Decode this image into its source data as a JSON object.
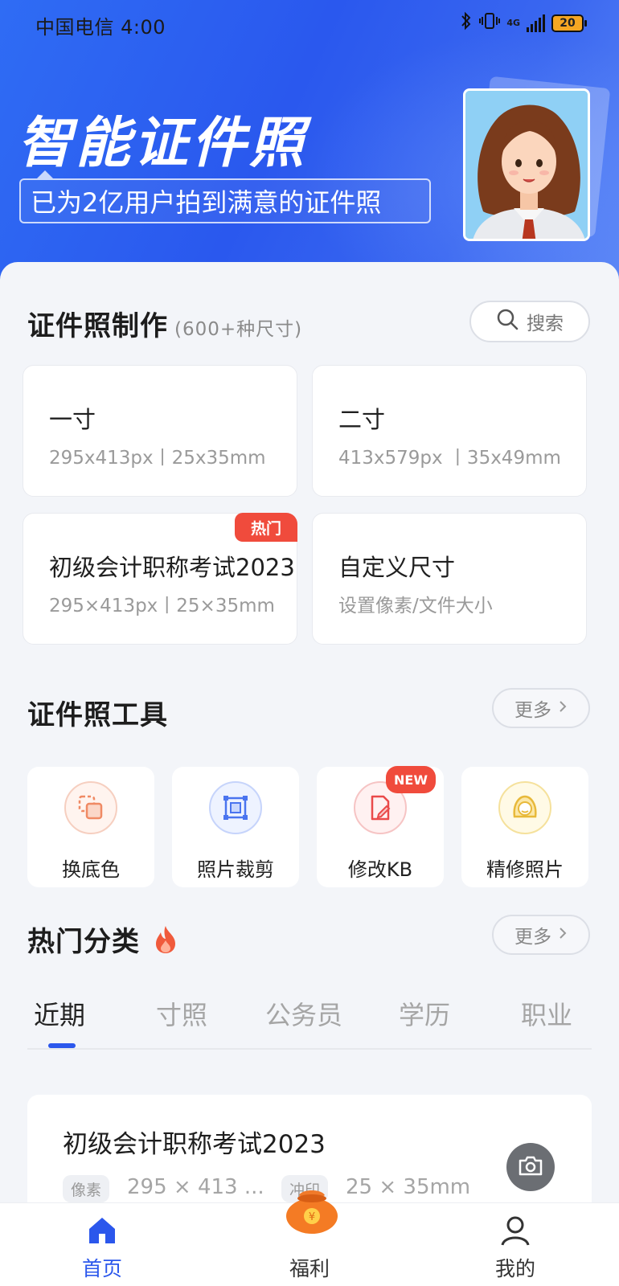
{
  "status_bar": {
    "carrier_time": "中国电信 4:00",
    "network": "4G",
    "battery": "20"
  },
  "hero": {
    "title": "智能证件照",
    "subtitle": "已为2亿用户拍到满意的证件照"
  },
  "make_section": {
    "title": "证件照制作",
    "note": "(600+种尺寸)",
    "search_label": "搜索",
    "cards": [
      {
        "title": "一寸",
        "sub": "295x413px丨25x35mm"
      },
      {
        "title": "二寸",
        "sub": "413x579px 丨35x49mm"
      },
      {
        "title": "初级会计职称考试2023",
        "sub": "295×413px丨25×35mm",
        "tag": "热门"
      },
      {
        "title": "自定义尺寸",
        "sub": "设置像素/文件大小"
      }
    ]
  },
  "tools_section": {
    "title": "证件照工具",
    "more_label": "更多",
    "tools": [
      {
        "label": "换底色",
        "icon": "swap-background-icon"
      },
      {
        "label": "照片裁剪",
        "icon": "crop-icon"
      },
      {
        "label": "修改KB",
        "icon": "edit-file-icon",
        "tag": "NEW"
      },
      {
        "label": "精修照片",
        "icon": "face-retouch-icon"
      }
    ]
  },
  "hot_section": {
    "title": "热门分类",
    "more_label": "更多",
    "tabs": [
      "近期",
      "寸照",
      "公务员",
      "学历",
      "职业"
    ],
    "active_tab": "近期",
    "item": {
      "title": "初级会计职称考试2023",
      "pixel_chip": "像素",
      "pixel_value": "295 × 413 ...",
      "print_chip": "冲印",
      "print_value": "25 × 35mm"
    }
  },
  "bottom_nav": {
    "items": [
      {
        "label": "首页",
        "icon": "home-icon"
      },
      {
        "label": "福利",
        "icon": "lucky-bag-icon"
      },
      {
        "label": "我的",
        "icon": "user-icon"
      }
    ],
    "active": "首页"
  },
  "colors": {
    "brand_blue": "#2b57ec",
    "hot_red": "#f04b3c"
  }
}
